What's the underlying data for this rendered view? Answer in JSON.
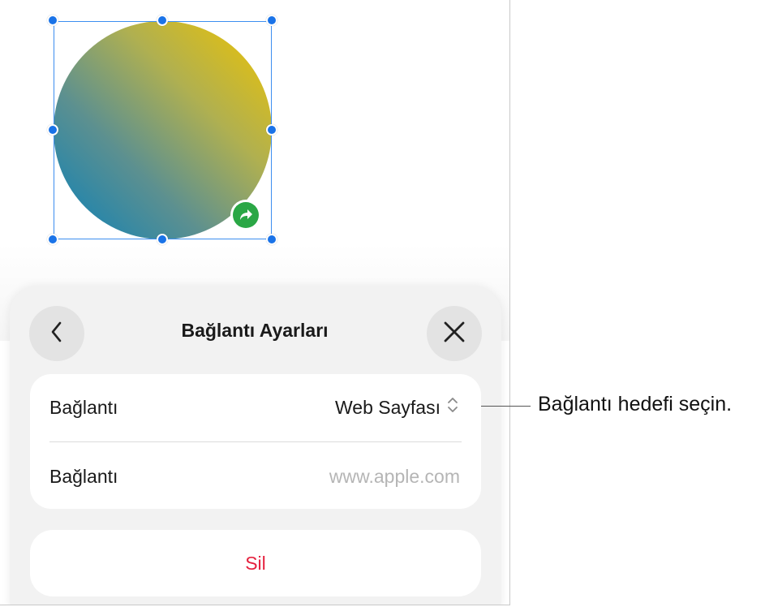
{
  "colors": {
    "selection": "#1a73e8",
    "link_badge": "#2aa745",
    "delete_text": "#e5223f",
    "gradient_start": "#f0c400",
    "gradient_end": "#0a80b8"
  },
  "panel": {
    "title": "Bağlantı Ayarları",
    "back_icon": "chevron-left-icon",
    "close_icon": "close-icon",
    "rows": [
      {
        "label": "Bağlantı",
        "value": "Web Sayfası",
        "icon": "up-down-chevron-icon"
      },
      {
        "label": "Bağlantı",
        "placeholder": "www.apple.com"
      }
    ],
    "delete_label": "Sil"
  },
  "callout": {
    "text": "Bağlantı hedefi seçin."
  }
}
